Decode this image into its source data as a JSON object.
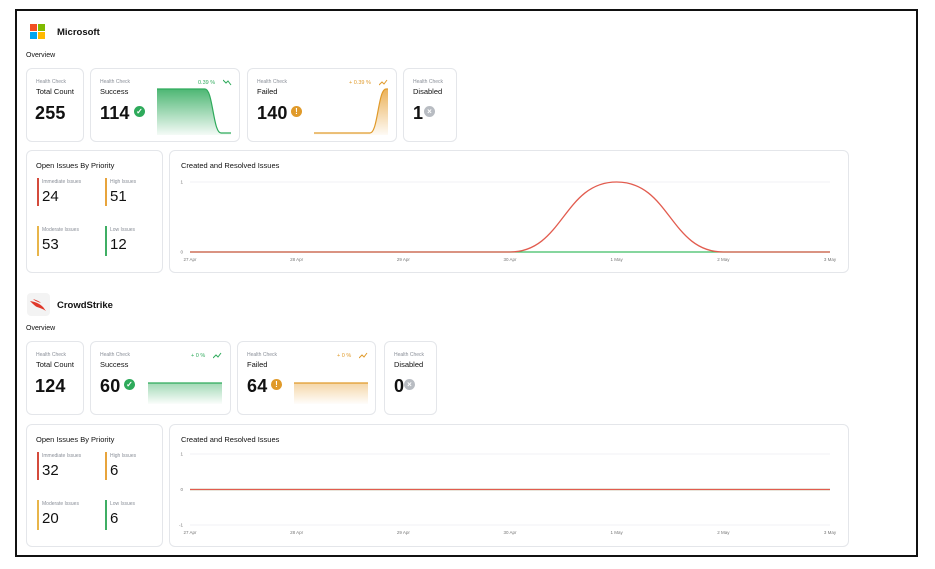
{
  "colors": {
    "success": "#2eaa5b",
    "failed": "#e09a2a",
    "disabled": "#b8bcc2",
    "immediate": "#d44b3c",
    "high": "#e8a43c",
    "moderate": "#e8b54a",
    "low": "#3fae64",
    "created": "#e25c4f",
    "resolved": "#3fbe63"
  },
  "providers": [
    {
      "name": "Microsoft",
      "logo_icon": "microsoft-logo",
      "overview_label": "Overview",
      "total": {
        "caption": "Health Check",
        "title": "Total Count",
        "value": "255"
      },
      "success": {
        "caption": "Health Check",
        "title": "Success",
        "value": "114",
        "change": "0.39 %",
        "trend_icon": "trend-down-icon"
      },
      "failed": {
        "caption": "Health Check",
        "title": "Failed",
        "value": "140",
        "change": "+ 0.39 %",
        "trend_icon": "trend-up-icon"
      },
      "disabled": {
        "caption": "Health Check",
        "title": "Disabled",
        "value": "1"
      },
      "issues": {
        "title": "Open Issues By Priority",
        "immediate_label": "Immediate Issues",
        "immediate": "24",
        "high_label": "High Issues",
        "high": "51",
        "moderate_label": "Moderate Issues",
        "moderate": "53",
        "low_label": "Low Issues",
        "low": "12"
      },
      "chart_data": {
        "type": "line",
        "title": "Created and Resolved Issues",
        "x": [
          "27 Apr",
          "28 Apr",
          "29 Apr",
          "30 Apr",
          "1 May",
          "2 May",
          "3 May"
        ],
        "ylim": [
          0,
          1
        ],
        "yticks": [
          "1",
          "0"
        ],
        "series": [
          {
            "values": [
              0,
              0,
              0,
              0,
              1,
              0,
              0
            ],
            "color": "#e25c4f"
          },
          {
            "values": [
              0,
              0,
              0,
              0,
              0,
              0,
              0
            ],
            "color": "#3fbe63"
          }
        ]
      }
    },
    {
      "name": "CrowdStrike",
      "logo_icon": "crowdstrike-falcon-logo",
      "overview_label": "Overview",
      "total": {
        "caption": "Health Check",
        "title": "Total Count",
        "value": "124"
      },
      "success": {
        "caption": "Health Check",
        "title": "Success",
        "value": "60",
        "change": "+ 0 %",
        "trend_icon": "trend-up-icon"
      },
      "failed": {
        "caption": "Health Check",
        "title": "Failed",
        "value": "64",
        "change": "+ 0 %",
        "trend_icon": "trend-up-icon"
      },
      "disabled": {
        "caption": "Health Check",
        "title": "Disabled",
        "value": "0"
      },
      "issues": {
        "title": "Open Issues By Priority",
        "immediate_label": "Immediate Issues",
        "immediate": "32",
        "high_label": "High Issues",
        "high": "6",
        "moderate_label": "Moderate Issues",
        "moderate": "20",
        "low_label": "Low Issues",
        "low": "6"
      },
      "chart_data": {
        "type": "line",
        "title": "Created and Resolved Issues",
        "x": [
          "27 Apr",
          "28 Apr",
          "29 Apr",
          "30 Apr",
          "1 May",
          "2 May",
          "3 May"
        ],
        "ylim": [
          -1,
          1
        ],
        "yticks": [
          "1",
          "0",
          "-1"
        ],
        "series": [
          {
            "values": [
              0,
              0,
              0,
              0,
              0,
              0,
              0
            ],
            "color": "#e25c4f"
          },
          {
            "values": [
              0,
              0,
              0,
              0,
              0,
              0,
              0
            ],
            "color": "#3fbe63"
          }
        ]
      }
    }
  ]
}
